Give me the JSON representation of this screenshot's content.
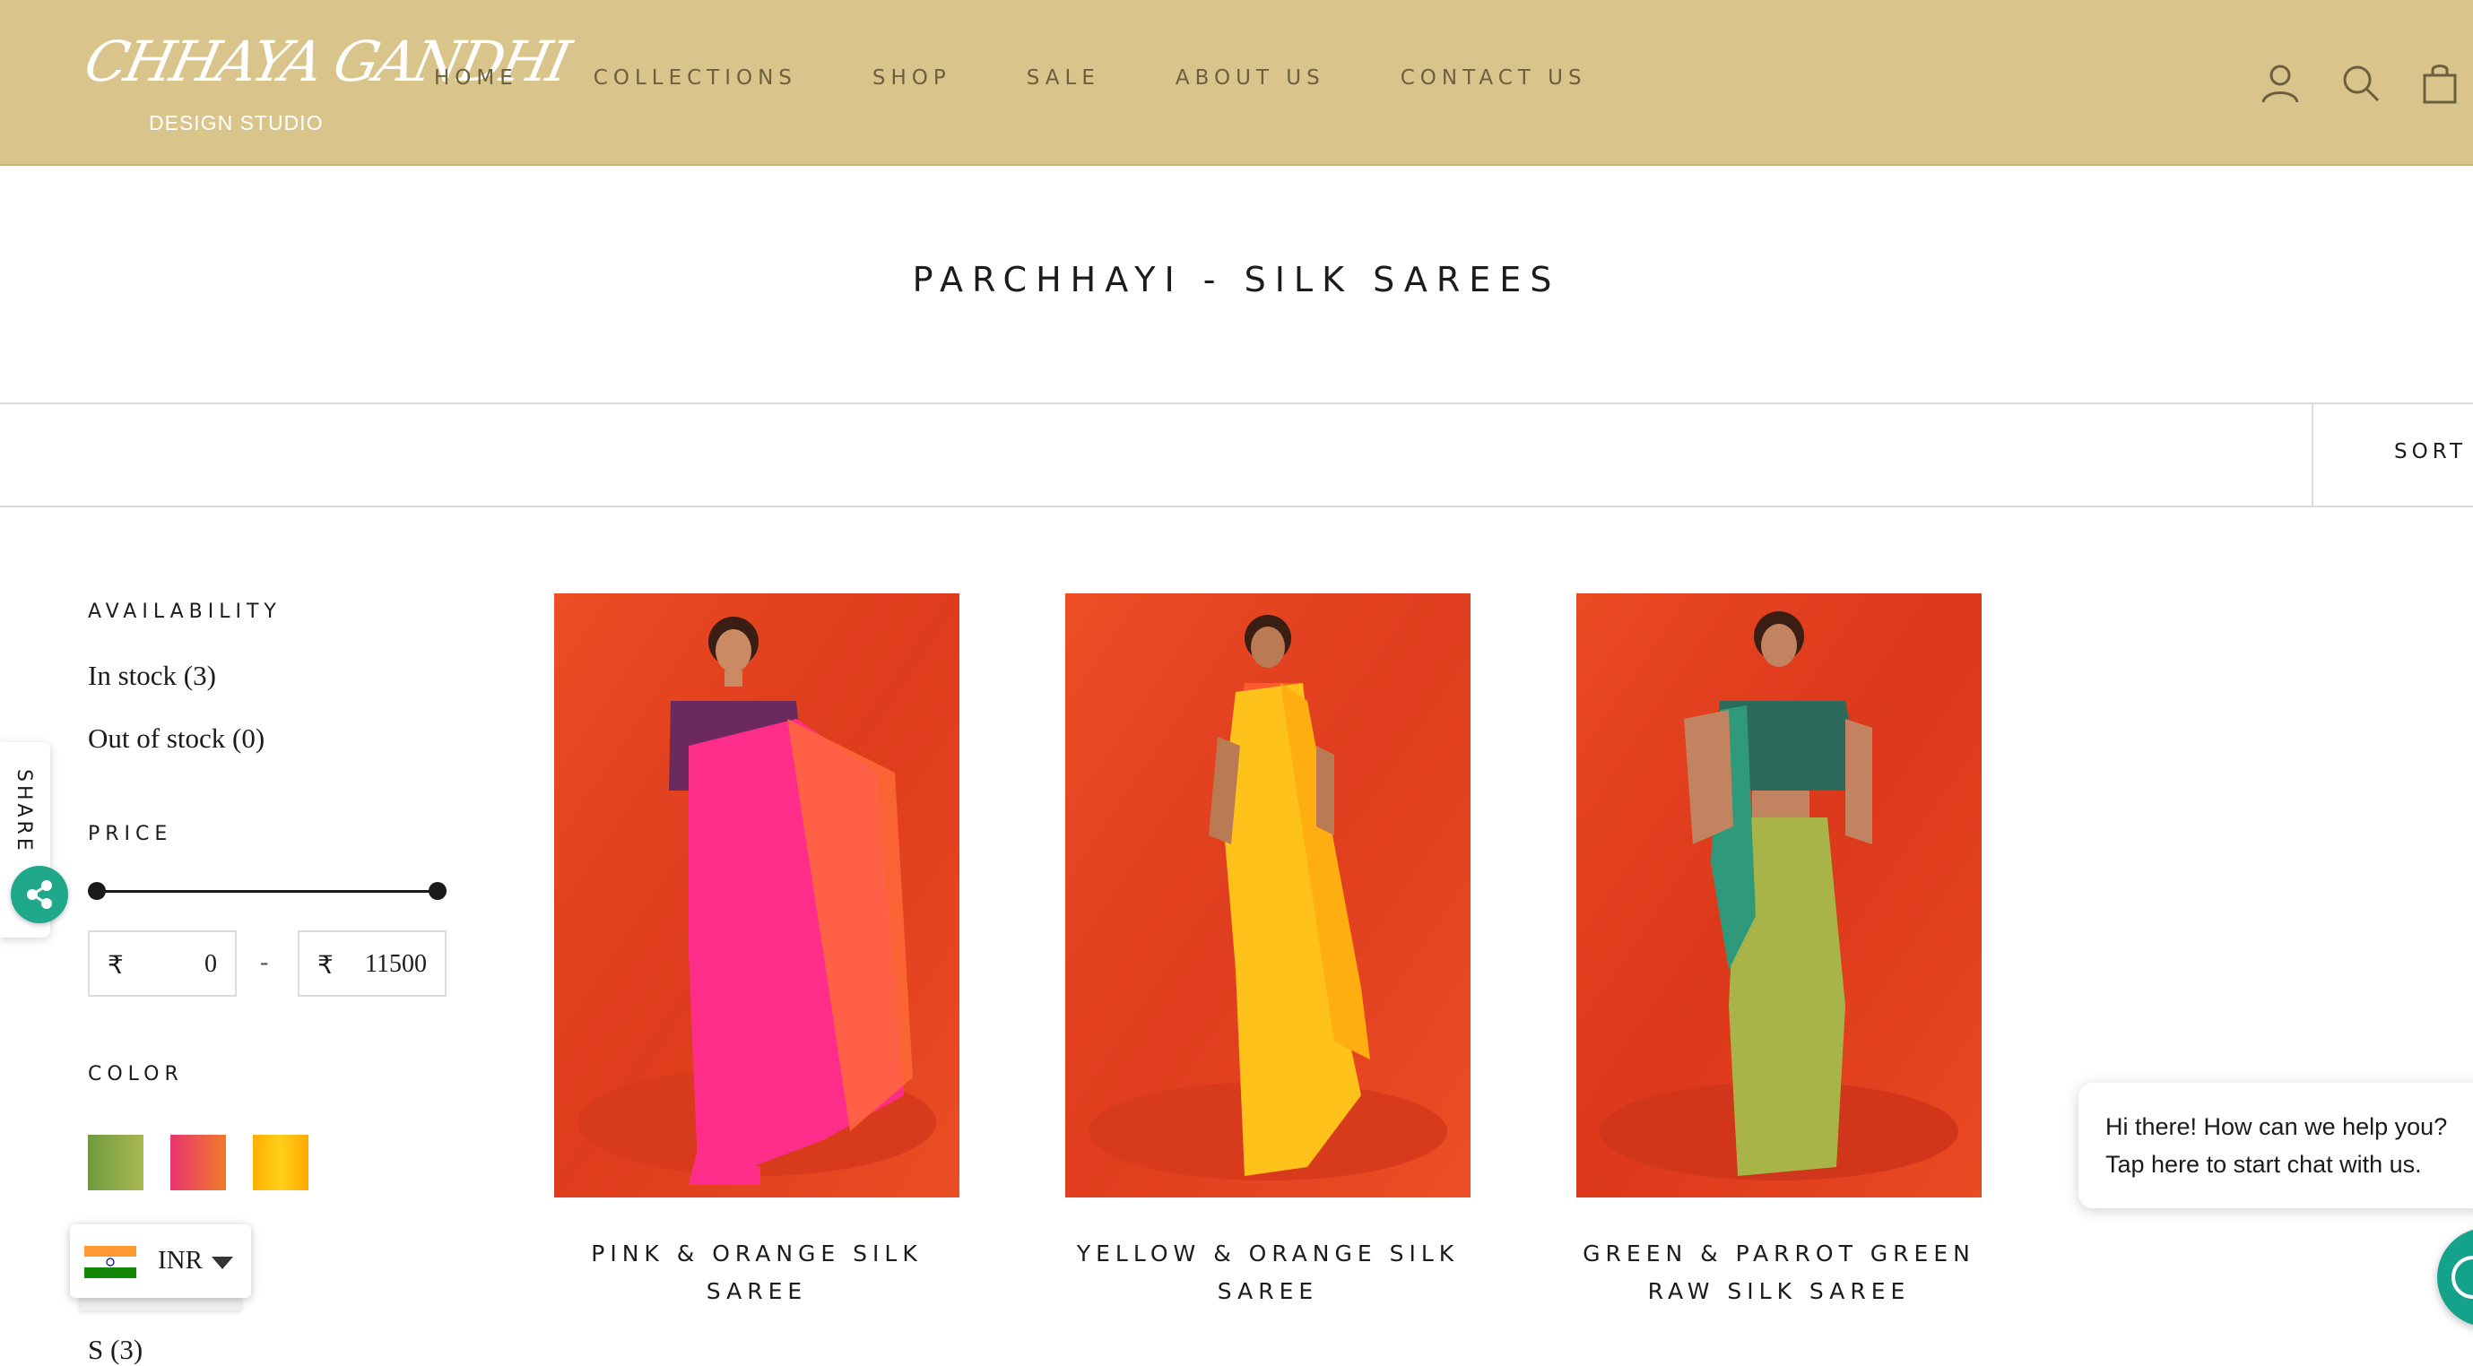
{
  "brand": {
    "name_script": "CHHAYA GANDHI",
    "subtitle": "DESIGN STUDIO"
  },
  "nav": {
    "items": [
      {
        "label": "HOME"
      },
      {
        "label": "COLLECTIONS"
      },
      {
        "label": "SHOP"
      },
      {
        "label": "SALE"
      },
      {
        "label": "ABOUT US"
      },
      {
        "label": "CONTACT US"
      }
    ]
  },
  "header_icons": [
    "account-icon",
    "search-icon",
    "cart-icon"
  ],
  "page": {
    "title": "PARCHHAYI - SILK SAREES"
  },
  "toolbar": {
    "sort_label": "SORT"
  },
  "filters": {
    "availability": {
      "heading": "AVAILABILITY",
      "options": [
        {
          "label": "In stock (3)"
        },
        {
          "label": "Out of stock (0)"
        }
      ]
    },
    "price": {
      "heading": "PRICE",
      "currency_symbol": "₹",
      "min": "0",
      "max": "11500",
      "separator": "-"
    },
    "color": {
      "heading": "COLOR",
      "swatches": [
        {
          "name": "green",
          "colors": [
            "#6f9a3f",
            "#a8b850"
          ]
        },
        {
          "name": "pink",
          "colors": [
            "#e8356e",
            "#f07a2a"
          ]
        },
        {
          "name": "yellow",
          "colors": [
            "#ffb000",
            "#ffcf1a"
          ]
        }
      ]
    },
    "size": {
      "options": [
        {
          "label": "S (3)"
        }
      ]
    }
  },
  "share": {
    "label": "SHARE"
  },
  "currency": {
    "code": "INR"
  },
  "products": [
    {
      "title": "PINK & ORANGE SILK SAREE",
      "colors": {
        "bg": "#e8421e",
        "blouse": "#6b2a5e",
        "drape": "#ff2d8a",
        "pallu": "#ff6a3a"
      }
    },
    {
      "title": "YELLOW & ORANGE SILK SAREE",
      "colors": {
        "bg": "#ea4420",
        "blouse": "#ff5a2e",
        "drape": "#ffc21a",
        "pallu": "#ffae12"
      }
    },
    {
      "title": "GREEN & PARROT GREEN RAW SILK SAREE",
      "colors": {
        "bg": "#e53d1c",
        "blouse": "#2d6a5c",
        "drape": "#a8b447",
        "pallu": "#2e9a7a"
      }
    }
  ],
  "chat": {
    "line1": "Hi there! How can we help you?",
    "line2": "Tap here to start chat with us."
  },
  "colors": {
    "header_bg": "#d9c58c",
    "nav_text": "#6b5f3f",
    "chat_green": "#14a38a"
  }
}
